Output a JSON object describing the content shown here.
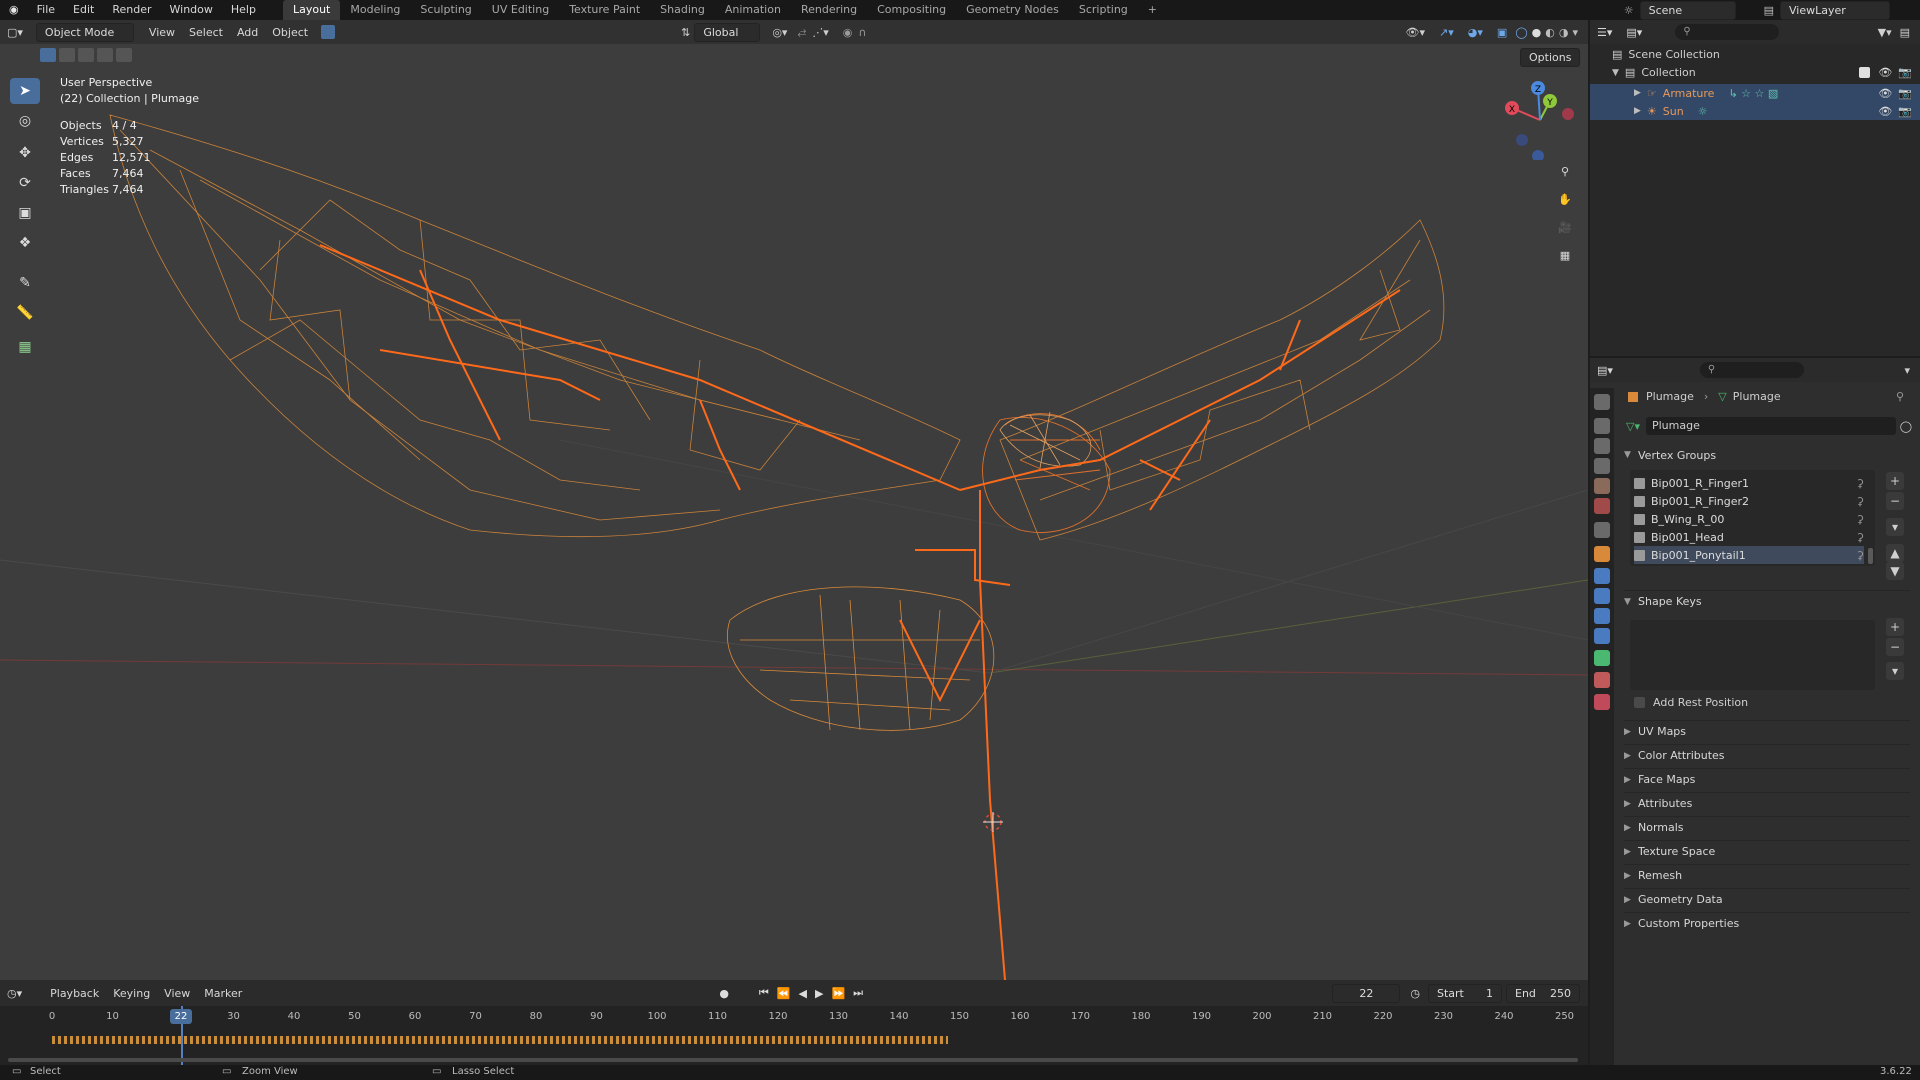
{
  "topbar": {
    "menus": [
      "File",
      "Edit",
      "Render",
      "Window",
      "Help"
    ],
    "workspaces": [
      "Layout",
      "Modeling",
      "Sculpting",
      "UV Editing",
      "Texture Paint",
      "Shading",
      "Animation",
      "Rendering",
      "Compositing",
      "Geometry Nodes",
      "Scripting"
    ],
    "active_workspace": "Layout",
    "scene_label": "Scene",
    "viewlayer_label": "ViewLayer"
  },
  "viewport": {
    "mode_label": "Object Mode",
    "menus": [
      "View",
      "Select",
      "Add",
      "Object"
    ],
    "orientation_label": "Global",
    "options_label": "Options",
    "overlay_title": "User Perspective",
    "overlay_subtitle": "(22) Collection | Plumage",
    "stats": [
      {
        "key": "Objects",
        "value": "4 / 4"
      },
      {
        "key": "Vertices",
        "value": "5,327"
      },
      {
        "key": "Edges",
        "value": "12,571"
      },
      {
        "key": "Faces",
        "value": "7,464"
      },
      {
        "key": "Triangles",
        "value": "7,464"
      }
    ],
    "gizmo_axes": [
      "X",
      "Y",
      "Z"
    ],
    "wire_color": "#e0702a"
  },
  "timeline": {
    "menus": [
      "Playback",
      "Keying",
      "View",
      "Marker"
    ],
    "current_frame": "22",
    "start_label": "Start",
    "start_value": "1",
    "end_label": "End",
    "end_value": "250",
    "ruler_labels": [
      "0",
      "10",
      "2",
      "30",
      "40",
      "50",
      "60",
      "70",
      "80",
      "90",
      "100",
      "110",
      "120",
      "130",
      "140",
      "150",
      "160",
      "170",
      "180",
      "190",
      "200",
      "210",
      "220",
      "230",
      "240",
      "250"
    ],
    "playhead_label": "22"
  },
  "statusbar": {
    "items": [
      "Select",
      "Zoom View",
      "Lasso Select"
    ],
    "version": "3.6.22"
  },
  "outliner": {
    "root": "Scene Collection",
    "collection": "Collection",
    "items": [
      "Armature",
      "Sun"
    ]
  },
  "properties": {
    "breadcrumb_object": "Plumage",
    "breadcrumb_data": "Plumage",
    "data_name": "Plumage",
    "vertex_groups_title": "Vertex Groups",
    "vertex_groups": [
      "Bip001_R_Finger1",
      "Bip001_R_Finger2",
      "B_Wing_R_00",
      "Bip001_Head",
      "Bip001_Ponytail1"
    ],
    "shape_keys_title": "Shape Keys",
    "add_rest_position_label": "Add Rest Position",
    "panels": [
      "UV Maps",
      "Color Attributes",
      "Face Maps",
      "Attributes",
      "Normals",
      "Texture Space",
      "Remesh",
      "Geometry Data",
      "Custom Properties"
    ]
  }
}
